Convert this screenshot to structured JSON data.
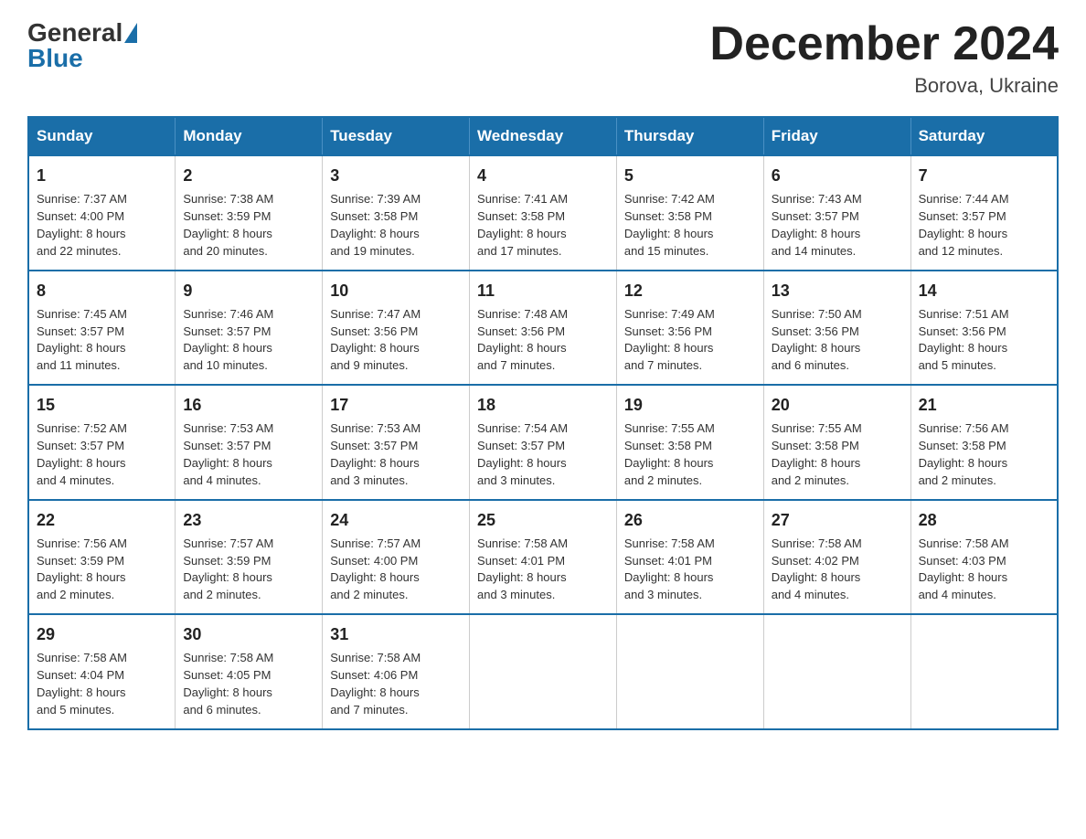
{
  "header": {
    "logo_general": "General",
    "logo_blue": "Blue",
    "month_title": "December 2024",
    "location": "Borova, Ukraine"
  },
  "days_of_week": [
    "Sunday",
    "Monday",
    "Tuesday",
    "Wednesday",
    "Thursday",
    "Friday",
    "Saturday"
  ],
  "weeks": [
    [
      {
        "day": "1",
        "sunrise": "7:37 AM",
        "sunset": "4:00 PM",
        "daylight": "8 hours and 22 minutes."
      },
      {
        "day": "2",
        "sunrise": "7:38 AM",
        "sunset": "3:59 PM",
        "daylight": "8 hours and 20 minutes."
      },
      {
        "day": "3",
        "sunrise": "7:39 AM",
        "sunset": "3:58 PM",
        "daylight": "8 hours and 19 minutes."
      },
      {
        "day": "4",
        "sunrise": "7:41 AM",
        "sunset": "3:58 PM",
        "daylight": "8 hours and 17 minutes."
      },
      {
        "day": "5",
        "sunrise": "7:42 AM",
        "sunset": "3:58 PM",
        "daylight": "8 hours and 15 minutes."
      },
      {
        "day": "6",
        "sunrise": "7:43 AM",
        "sunset": "3:57 PM",
        "daylight": "8 hours and 14 minutes."
      },
      {
        "day": "7",
        "sunrise": "7:44 AM",
        "sunset": "3:57 PM",
        "daylight": "8 hours and 12 minutes."
      }
    ],
    [
      {
        "day": "8",
        "sunrise": "7:45 AM",
        "sunset": "3:57 PM",
        "daylight": "8 hours and 11 minutes."
      },
      {
        "day": "9",
        "sunrise": "7:46 AM",
        "sunset": "3:57 PM",
        "daylight": "8 hours and 10 minutes."
      },
      {
        "day": "10",
        "sunrise": "7:47 AM",
        "sunset": "3:56 PM",
        "daylight": "8 hours and 9 minutes."
      },
      {
        "day": "11",
        "sunrise": "7:48 AM",
        "sunset": "3:56 PM",
        "daylight": "8 hours and 7 minutes."
      },
      {
        "day": "12",
        "sunrise": "7:49 AM",
        "sunset": "3:56 PM",
        "daylight": "8 hours and 7 minutes."
      },
      {
        "day": "13",
        "sunrise": "7:50 AM",
        "sunset": "3:56 PM",
        "daylight": "8 hours and 6 minutes."
      },
      {
        "day": "14",
        "sunrise": "7:51 AM",
        "sunset": "3:56 PM",
        "daylight": "8 hours and 5 minutes."
      }
    ],
    [
      {
        "day": "15",
        "sunrise": "7:52 AM",
        "sunset": "3:57 PM",
        "daylight": "8 hours and 4 minutes."
      },
      {
        "day": "16",
        "sunrise": "7:53 AM",
        "sunset": "3:57 PM",
        "daylight": "8 hours and 4 minutes."
      },
      {
        "day": "17",
        "sunrise": "7:53 AM",
        "sunset": "3:57 PM",
        "daylight": "8 hours and 3 minutes."
      },
      {
        "day": "18",
        "sunrise": "7:54 AM",
        "sunset": "3:57 PM",
        "daylight": "8 hours and 3 minutes."
      },
      {
        "day": "19",
        "sunrise": "7:55 AM",
        "sunset": "3:58 PM",
        "daylight": "8 hours and 2 minutes."
      },
      {
        "day": "20",
        "sunrise": "7:55 AM",
        "sunset": "3:58 PM",
        "daylight": "8 hours and 2 minutes."
      },
      {
        "day": "21",
        "sunrise": "7:56 AM",
        "sunset": "3:58 PM",
        "daylight": "8 hours and 2 minutes."
      }
    ],
    [
      {
        "day": "22",
        "sunrise": "7:56 AM",
        "sunset": "3:59 PM",
        "daylight": "8 hours and 2 minutes."
      },
      {
        "day": "23",
        "sunrise": "7:57 AM",
        "sunset": "3:59 PM",
        "daylight": "8 hours and 2 minutes."
      },
      {
        "day": "24",
        "sunrise": "7:57 AM",
        "sunset": "4:00 PM",
        "daylight": "8 hours and 2 minutes."
      },
      {
        "day": "25",
        "sunrise": "7:58 AM",
        "sunset": "4:01 PM",
        "daylight": "8 hours and 3 minutes."
      },
      {
        "day": "26",
        "sunrise": "7:58 AM",
        "sunset": "4:01 PM",
        "daylight": "8 hours and 3 minutes."
      },
      {
        "day": "27",
        "sunrise": "7:58 AM",
        "sunset": "4:02 PM",
        "daylight": "8 hours and 4 minutes."
      },
      {
        "day": "28",
        "sunrise": "7:58 AM",
        "sunset": "4:03 PM",
        "daylight": "8 hours and 4 minutes."
      }
    ],
    [
      {
        "day": "29",
        "sunrise": "7:58 AM",
        "sunset": "4:04 PM",
        "daylight": "8 hours and 5 minutes."
      },
      {
        "day": "30",
        "sunrise": "7:58 AM",
        "sunset": "4:05 PM",
        "daylight": "8 hours and 6 minutes."
      },
      {
        "day": "31",
        "sunrise": "7:58 AM",
        "sunset": "4:06 PM",
        "daylight": "8 hours and 7 minutes."
      },
      null,
      null,
      null,
      null
    ]
  ],
  "labels": {
    "sunrise": "Sunrise:",
    "sunset": "Sunset:",
    "daylight": "Daylight:"
  }
}
